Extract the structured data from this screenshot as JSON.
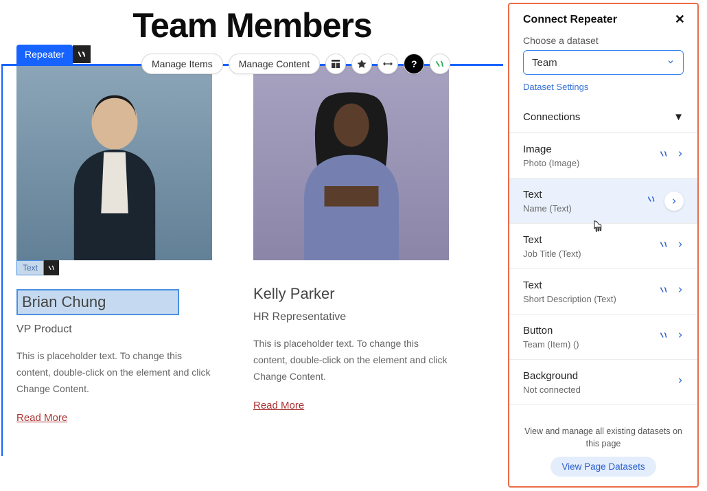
{
  "page": {
    "title": "Team Members"
  },
  "repeater": {
    "badge_label": "Repeater",
    "toolbar": {
      "manage_items": "Manage Items",
      "manage_content": "Manage Content"
    }
  },
  "text_badge_label": "Text",
  "cards": [
    {
      "name": "Brian Chung",
      "role": "VP Product",
      "desc": "This is placeholder text. To change this content, double-click on the element and click Change Content.",
      "link": "Read More"
    },
    {
      "name": "Kelly Parker",
      "role": "HR Representative",
      "desc": "This is placeholder text. To change this content, double-click on the element and click Change Content.",
      "link": "Read More"
    }
  ],
  "panel": {
    "title": "Connect Repeater",
    "choose_label": "Choose a dataset",
    "select_value": "Team",
    "dataset_settings": "Dataset Settings",
    "connections_header": "Connections",
    "connections": [
      {
        "title": "Image",
        "sub": "Photo (Image)",
        "connected": true
      },
      {
        "title": "Text",
        "sub": "Name (Text)",
        "connected": true,
        "highlight": true
      },
      {
        "title": "Text",
        "sub": "Job Title (Text)",
        "connected": true
      },
      {
        "title": "Text",
        "sub": "Short Description (Text)",
        "connected": true
      },
      {
        "title": "Button",
        "sub": "Team (Item) ()",
        "connected": true
      },
      {
        "title": "Background",
        "sub": "Not connected",
        "connected": false
      }
    ],
    "footer_text": "View and manage all existing datasets on this page",
    "footer_button": "View Page Datasets"
  }
}
